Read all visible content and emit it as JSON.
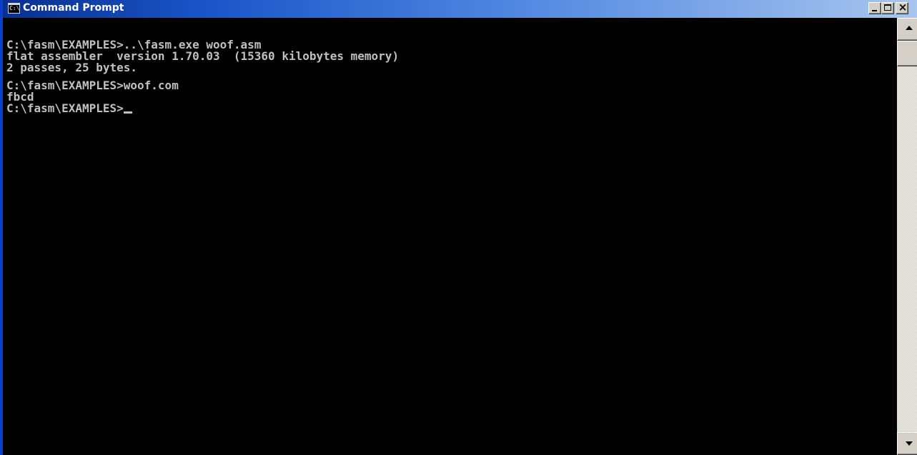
{
  "window": {
    "title": "Command Prompt",
    "icon": "console-icon",
    "icon_glyph": "C:\\"
  },
  "caption_buttons": {
    "minimize": "minimize-icon",
    "maximize": "maximize-icon",
    "close": "close-icon",
    "close_glyph": "×"
  },
  "console": {
    "lines": [
      "C:\\fasm\\EXAMPLES>..\\fasm.exe woof.asm",
      "flat assembler  version 1.70.03  (15360 kilobytes memory)",
      "2 passes, 25 bytes.",
      "",
      "C:\\fasm\\EXAMPLES>woof.com",
      "fbcd",
      "C:\\fasm\\EXAMPLES>"
    ],
    "text_color": "#c0c0c0",
    "background": "#000000"
  },
  "scrollbar": {
    "up": "scroll-up-icon",
    "down": "scroll-down-icon"
  }
}
